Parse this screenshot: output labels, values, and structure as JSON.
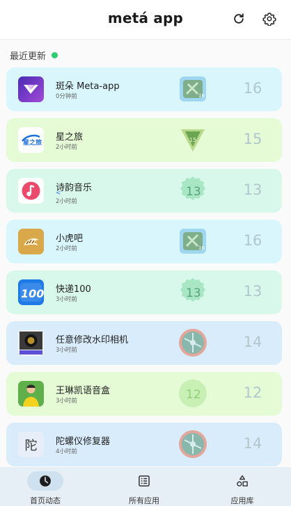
{
  "header": {
    "title": "metá app"
  },
  "section": {
    "label": "最近更新"
  },
  "apps": [
    {
      "name": "斑朵 Meta-app",
      "time": "0分钟前",
      "version": "16",
      "bg": "#d8f6fb",
      "icon": "banduo-icon"
    },
    {
      "name": "星之旅",
      "time": "2小时前",
      "version": "15",
      "bg": "#e4fbd6",
      "icon": "xingzhilv-icon"
    },
    {
      "name": "诗韵音乐",
      "time": "2小时前",
      "version": "13",
      "bg": "#d9f8ec",
      "icon": "music-icon",
      "sub": "<"
    },
    {
      "name": "小虎吧",
      "time": "2小时前",
      "version": "16",
      "bg": "#d8f6fb",
      "icon": "tiger-icon"
    },
    {
      "name": "快递100",
      "time": "3小时前",
      "version": "13",
      "bg": "#d9f8ec",
      "icon": "kuaidi100-icon"
    },
    {
      "name": "任意修改水印相机",
      "time": "3小时前",
      "version": "14",
      "bg": "#d9ecfb",
      "icon": "camera-icon"
    },
    {
      "name": "王琳凯语音盒",
      "time": "3小时前",
      "version": "12",
      "bg": "#e4fbd6",
      "icon": "avatar-icon"
    },
    {
      "name": "陀螺仪修复器",
      "time": "4小时前",
      "version": "14",
      "bg": "#d9ecfb",
      "icon": "tuo-icon"
    }
  ],
  "nav": [
    {
      "label": "首页动态",
      "active": true
    },
    {
      "label": "所有应用",
      "active": false
    },
    {
      "label": "应用库",
      "active": false
    }
  ],
  "icon_glyphs": {
    "tuo": "陀",
    "kuaidi": "100"
  }
}
